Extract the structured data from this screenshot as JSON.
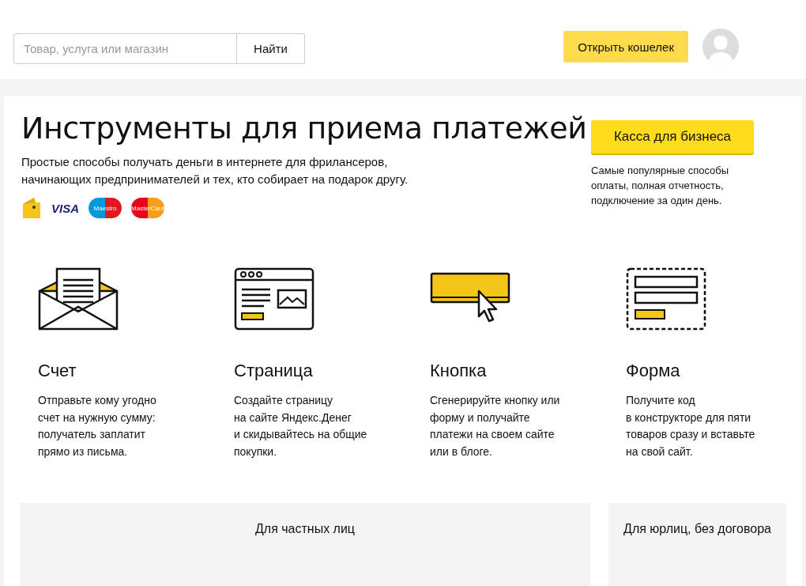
{
  "header": {
    "search": {
      "placeholder": "Товар, услуга или магазин",
      "button": "Найти"
    },
    "wallet_button": "Открыть кошелек"
  },
  "hero": {
    "title": "Инструменты для приема платежей",
    "subtitle": "Простые способы получать деньги в интернете для фрилансеров,\nначинающих предпринимателей и тех, кто собирает на подарок другу.",
    "payment_logos": [
      {
        "kind": "wallet"
      },
      {
        "kind": "visa",
        "label": "VISA"
      },
      {
        "kind": "maestro",
        "label": "Maestro"
      },
      {
        "kind": "mastercard",
        "label": "MasterCard"
      }
    ],
    "business_button": "Касса для бизнеса",
    "business_note": "Самые популярные способы\nоплаты, полная отчетность,\nподключение за один день."
  },
  "features": [
    {
      "kind": "invoice",
      "title": "Счет",
      "text": "Отправьте кому угодно\nсчет на нужную сумму:\nполучатель заплатит\nпрямо из письма."
    },
    {
      "kind": "page",
      "title": "Страница",
      "text": "Создайте страницу\nна сайте Яндекс.Денег\nи скидывайтесь на общие\nпокупки."
    },
    {
      "kind": "button",
      "title": "Кнопка",
      "text": "Сгенерируйте кнопку или\nформу и получайте\nплатежи на своем сайте\nили в блоге."
    },
    {
      "kind": "form",
      "title": "Форма",
      "text": "Получите код\nв конструкторе для пяти\nтоваров сразу и вставьте\nна свой сайт."
    }
  ],
  "tabs": [
    {
      "label": "Для частных лиц"
    },
    {
      "label": "Для юрлиц, без договора"
    }
  ]
}
